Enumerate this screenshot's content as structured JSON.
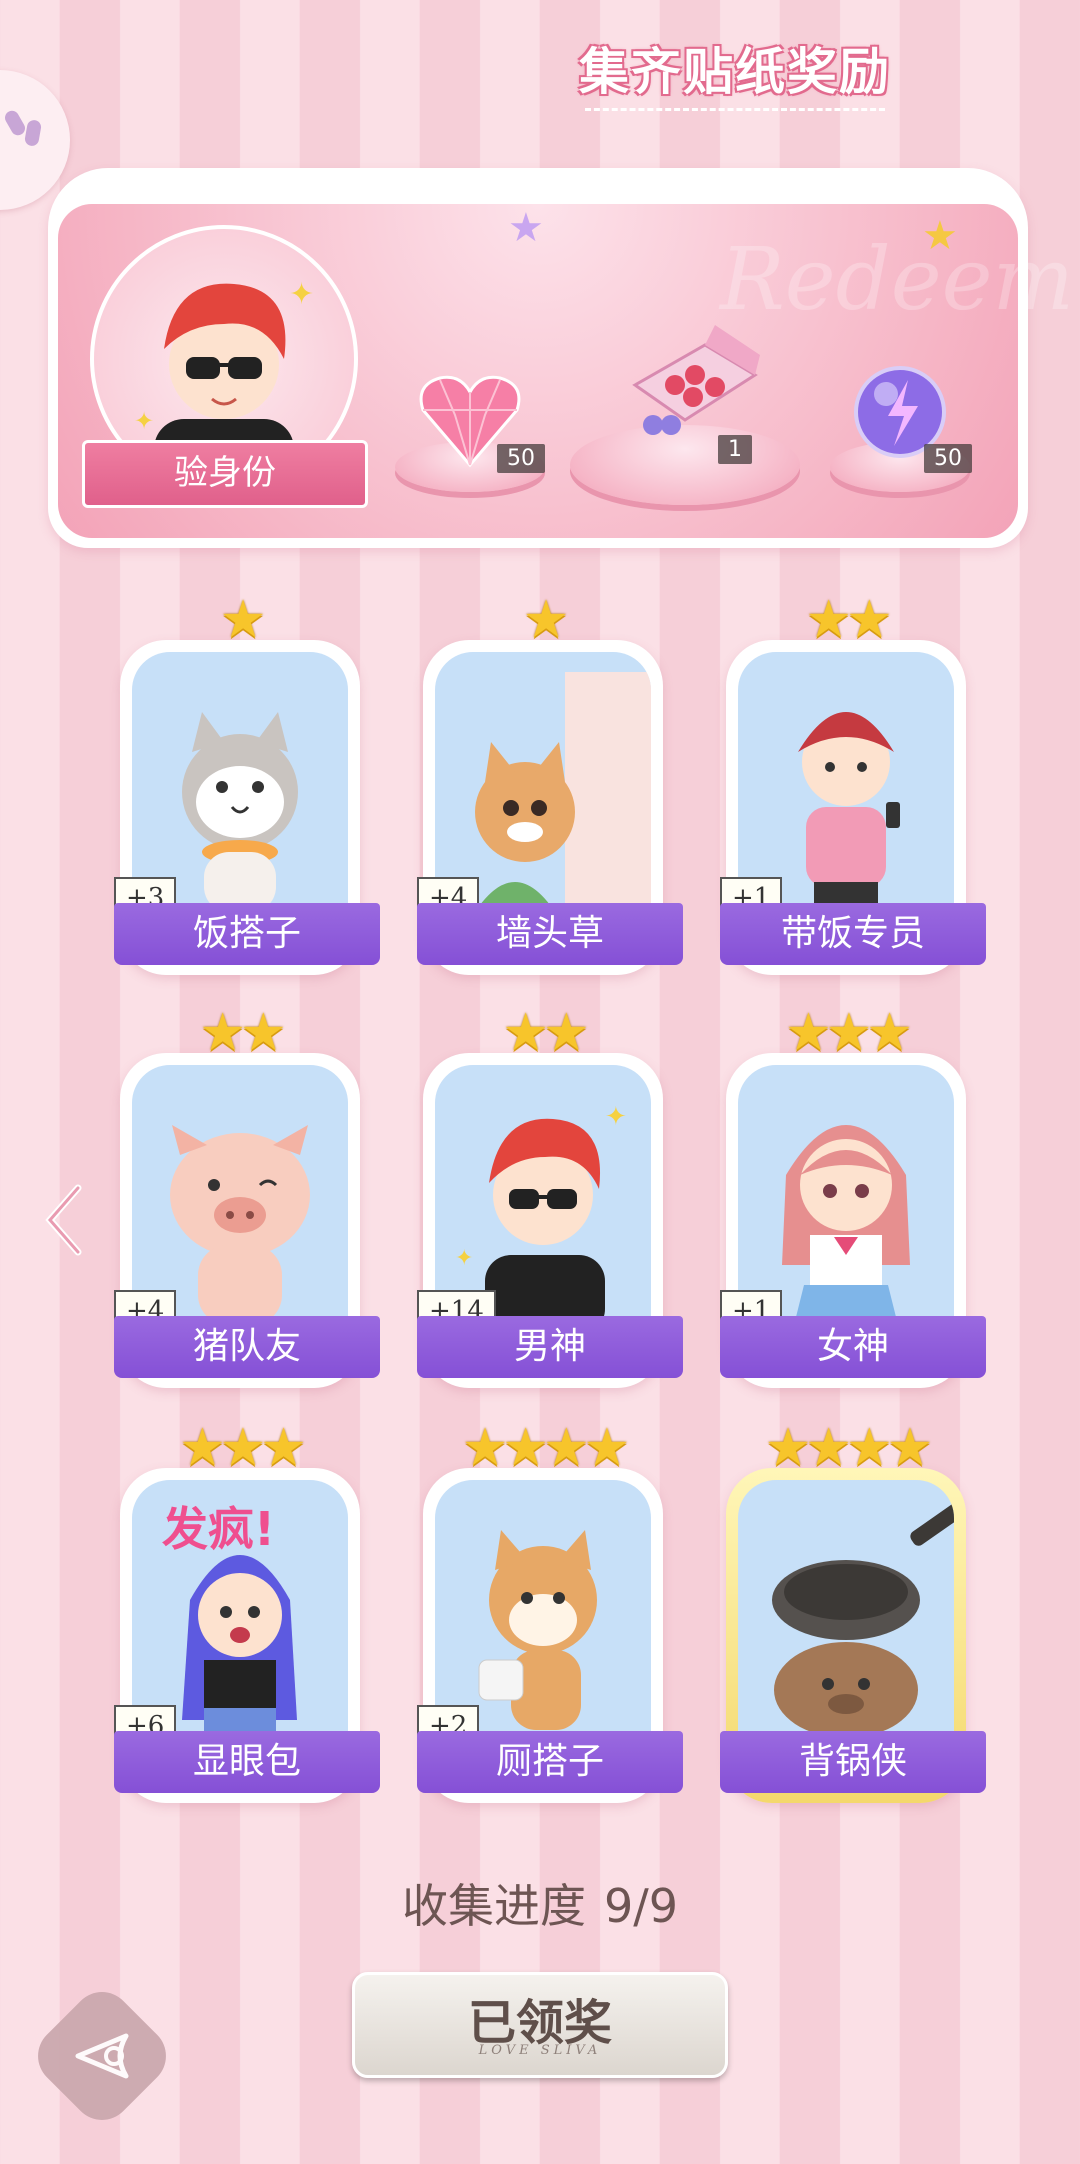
{
  "banner": {
    "title": "集齐贴纸奖励",
    "watermark": "Redeem",
    "avatar_label": "验身份",
    "rewards": [
      {
        "icon": "pink-heart-gem-icon",
        "count": "50"
      },
      {
        "icon": "gift-box-icon",
        "count": "1"
      },
      {
        "icon": "purple-energy-orb-icon",
        "count": "50"
      }
    ]
  },
  "cards": [
    {
      "name": "饭搭子",
      "plus": "+3",
      "stars": "★",
      "art": "cat-eating-icon"
    },
    {
      "name": "墙头草",
      "plus": "+4",
      "stars": "★",
      "art": "cat-peeking-wall-icon"
    },
    {
      "name": "带饭专员",
      "plus": "+1",
      "stars": "★★",
      "art": "girl-with-phone-icon"
    },
    {
      "name": "猪队友",
      "plus": "+4",
      "stars": "★★",
      "art": "pig-icon"
    },
    {
      "name": "男神",
      "plus": "+14",
      "stars": "★★",
      "art": "boy-sunglasses-icon"
    },
    {
      "name": "女神",
      "plus": "+1",
      "stars": "★★★",
      "art": "girl-sailor-icon"
    },
    {
      "name": "显眼包",
      "plus": "+6",
      "stars": "★★★",
      "art": "girl-crazy-icon",
      "overlay": "发疯!"
    },
    {
      "name": "厕搭子",
      "plus": "+2",
      "stars": "★★★★",
      "art": "shiba-toilet-paper-icon"
    },
    {
      "name": "背锅侠",
      "plus": "",
      "stars": "★★★★",
      "art": "capybara-pan-icon"
    }
  ],
  "progress": {
    "label": "收集进度",
    "value": "9/9"
  },
  "claim_button": {
    "label": "已领奖",
    "sub": "LOVE SLIVA"
  },
  "colors": {
    "accent_purple": "#8550d6",
    "banner_pink": "#f6b6c6",
    "star_gold": "#f7c52b"
  }
}
